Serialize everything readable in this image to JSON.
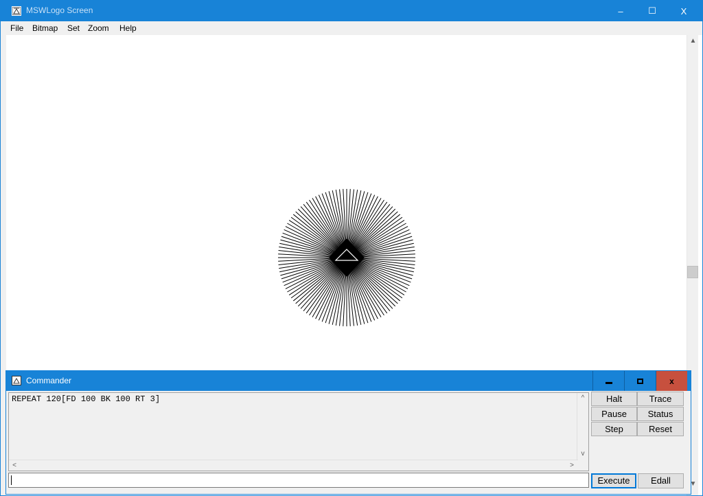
{
  "main_window": {
    "title": "MSWLogo Screen",
    "controls": {
      "minimize": "–",
      "maximize": "☐",
      "close": "X"
    }
  },
  "menu": {
    "items": [
      "File",
      "Bitmap",
      "Set",
      "Zoom",
      "Help"
    ]
  },
  "drawing": {
    "rays": 120,
    "ray_length": 100,
    "turn_degrees": 3,
    "line_color": "#000000",
    "background": "#ffffff"
  },
  "commander": {
    "title": "Commander",
    "history_text": "REPEAT 120[FD 100 BK 100 RT 3]",
    "input_value": "",
    "buttons": {
      "halt": "Halt",
      "trace": "Trace",
      "pause": "Pause",
      "status": "Status",
      "step": "Step",
      "reset": "Reset",
      "execute": "Execute",
      "edall": "Edall"
    }
  },
  "colors": {
    "titlebar": "#1883d7",
    "close_active": "#c7503e",
    "panel": "#f0f0f0"
  }
}
